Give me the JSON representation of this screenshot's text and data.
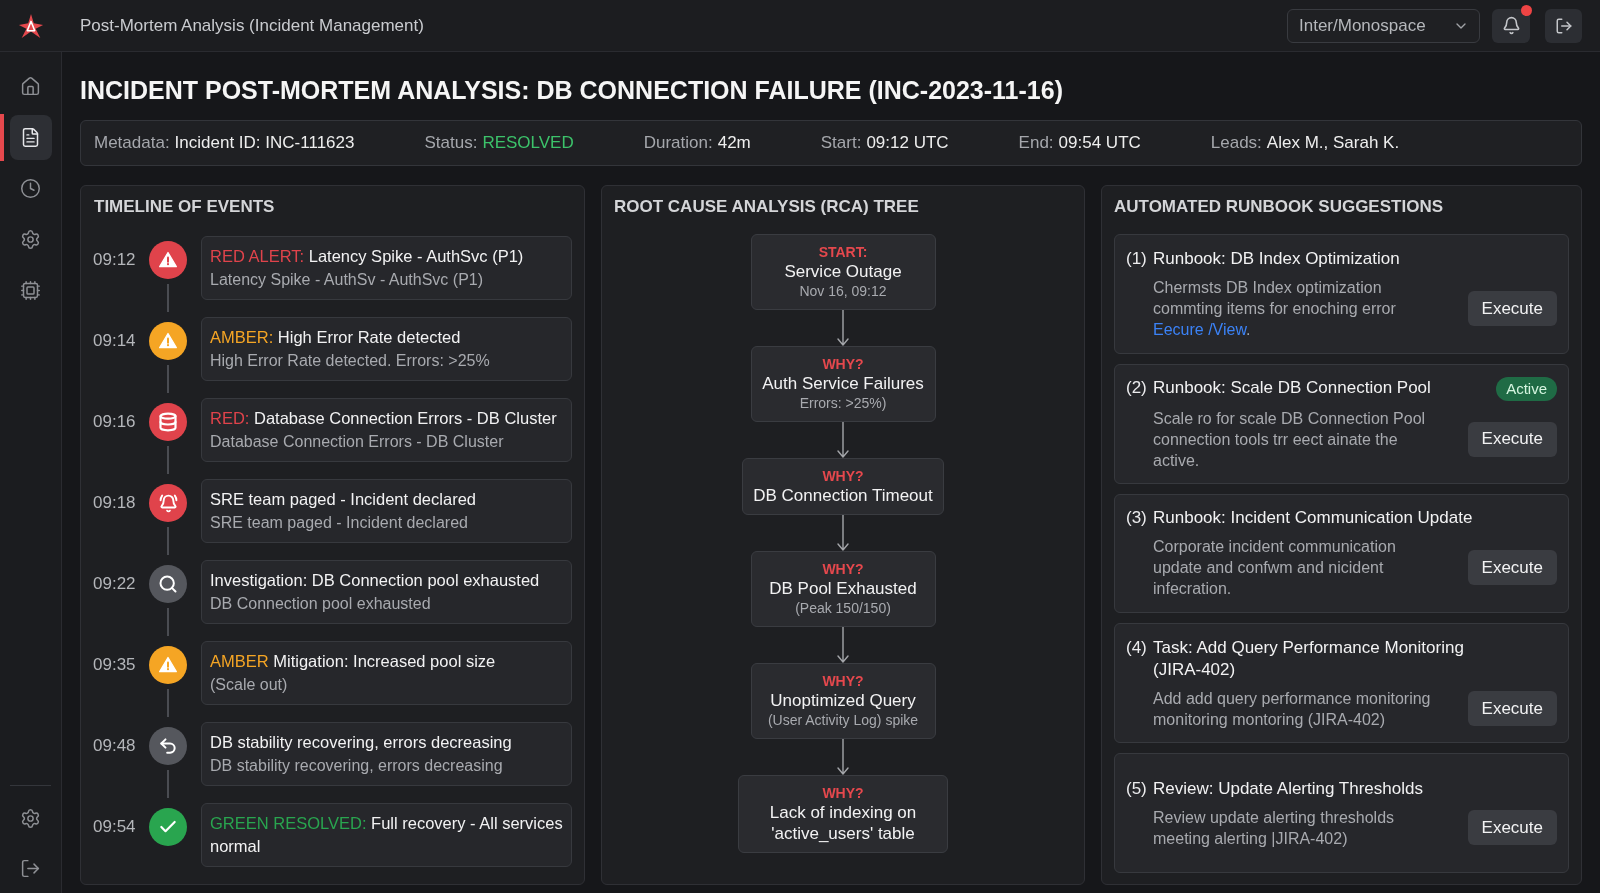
{
  "top_bar": {
    "title": "Post-Mortem Analysis (Incident Management)",
    "font_select": {
      "value": "Inter/Monospace"
    },
    "notifications": {
      "unread": true
    }
  },
  "sidebar": {
    "items": [
      {
        "kind": "home",
        "selected": false
      },
      {
        "kind": "document",
        "selected": true
      },
      {
        "kind": "history",
        "selected": false
      },
      {
        "kind": "settings",
        "selected": false
      },
      {
        "kind": "integrations",
        "selected": false
      }
    ]
  },
  "page": {
    "title": "INCIDENT POST-MORTEM ANALYSIS: DB CONNECTION FAILURE (INC-2023-11-16)"
  },
  "metadata": [
    {
      "kind": "text",
      "label": "Metadata:",
      "value": "Incident ID: INC-111623"
    },
    {
      "kind": "status",
      "label": "Status:",
      "value": "RESOLVED"
    },
    {
      "kind": "text",
      "label": "Duration:",
      "value": "42m"
    },
    {
      "kind": "text",
      "label": "Start:",
      "value": "09:12 UTC"
    },
    {
      "kind": "text",
      "label": "End:",
      "value": "09:54 UTC"
    },
    {
      "kind": "text",
      "label": "Leads:",
      "value": "Alex M., Sarah K."
    }
  ],
  "timeline": {
    "title": "TIMELINE OF EVENTS",
    "events": [
      {
        "time": "09:12",
        "kind": "alert",
        "color": "#e0434b",
        "prefix": "RED ALERT:",
        "title": "Latency Spike - AuthSvc (P1)",
        "detail": "Latency Spike - AuthSv - AuthSvc (P1)"
      },
      {
        "time": "09:14",
        "kind": "alert",
        "color": "#f5a524",
        "prefix": "AMBER:",
        "title": "High Error Rate detected",
        "detail": "High Error Rate detected. Errors: >25%"
      },
      {
        "time": "09:16",
        "kind": "database",
        "color": "#e0434b",
        "prefix": "RED:",
        "title": "Database Connection Errors - DB Cluster",
        "detail": "Database Connection Errors - DB Cluster"
      },
      {
        "time": "09:18",
        "kind": "paging",
        "color": "#e0434b",
        "title": "SRE team paged - Incident declared",
        "detail": "SRE team paged - Incident declared"
      },
      {
        "time": "09:22",
        "kind": "investigation",
        "color": "#55575d",
        "title": "Investigation: DB Connection pool exhausted",
        "detail": "DB Connection pool exhausted"
      },
      {
        "time": "09:35",
        "kind": "alert",
        "color": "#f5a524",
        "prefix": "AMBER",
        "title": "Mitigation: Increased pool size",
        "detail": "(Scale out)"
      },
      {
        "time": "09:48",
        "kind": "recovery",
        "color": "#55575d",
        "title": "DB stability recovering, errors decreasing",
        "detail": "DB stability recovering, errors decreasing"
      },
      {
        "time": "09:54",
        "kind": "resolved",
        "color": "#29a54f",
        "prefix": "GREEN RESOLVED:",
        "title": "Full recovery - All services normal"
      }
    ]
  },
  "rca": {
    "title": "ROOT CAUSE ANALYSIS (RCA) TREE",
    "nodes": [
      {
        "label": "START:",
        "title": "Service Outage",
        "detail": "Nov 16, 09:12"
      },
      {
        "label": "WHY?",
        "title": "Auth Service Failures",
        "detail": "Errors: >25%)"
      },
      {
        "label": "WHY?",
        "title": "DB Connection Timeout"
      },
      {
        "label": "WHY?",
        "title": "DB Pool Exhausted",
        "detail": "(Peak 150/150)"
      },
      {
        "label": "WHY?",
        "title": "Unoptimized Query",
        "detail": "(User Activity Log) spike"
      },
      {
        "label": "WHY?",
        "title": "Lack of indexing on 'active_users' table"
      }
    ]
  },
  "runbooks": {
    "title": "AUTOMATED RUNBOOK SUGGESTIONS",
    "items": [
      {
        "number": "(1)",
        "title": "Runbook: DB Index Optimization",
        "description": "Chermsts DB Index optimization commting items for enoching error",
        "link": "Eecure /View",
        "description_end": ".",
        "button": "Execute"
      },
      {
        "number": "(2)",
        "title": "Runbook: Scale DB Connection Pool",
        "badge": "Active",
        "description": "Scale ro for scale DB Connection Pool connection tools trr eect ainate the active.",
        "button": "Execute"
      },
      {
        "number": "(3)",
        "title": "Runbook: Incident Communication Update",
        "description": "Corporate incident communication update and confwm and nicident infecration.",
        "button": "Execute"
      },
      {
        "number": "(4)",
        "title": "Task: Add Query Performance Monitoring (JIRA-402)",
        "description": "Add add query performance monitoring monitoring montoring (JIRA-402)",
        "button": "Execute"
      },
      {
        "number": "(5)",
        "title": "Review: Update Alerting Thresholds",
        "description": "Review update alerting thresholds meeting alerting |JIRA-402)",
        "button": "Execute"
      }
    ]
  }
}
